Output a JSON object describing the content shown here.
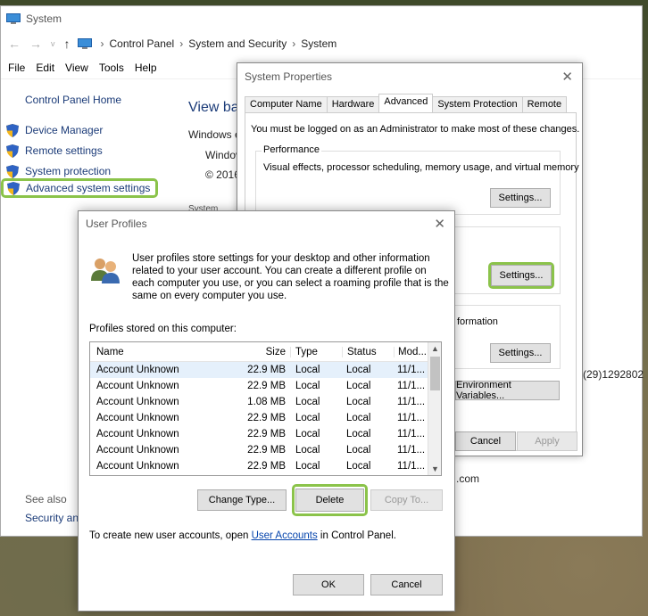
{
  "window": {
    "title": "System"
  },
  "address": {
    "crumbs": [
      "Control Panel",
      "System and Security",
      "System"
    ]
  },
  "menu": [
    "File",
    "Edit",
    "View",
    "Tools",
    "Help"
  ],
  "sidebar": {
    "home": "Control Panel Home",
    "items": [
      {
        "label": "Device Manager"
      },
      {
        "label": "Remote settings"
      },
      {
        "label": "System protection"
      },
      {
        "label": "Advanced system settings"
      }
    ],
    "see_also": "See also",
    "security": "Security and"
  },
  "content": {
    "title": "View bas",
    "line1": "Windows e",
    "line2": "Windov",
    "line3": "© 2016",
    "line4": "System",
    "frag_phone": "(29)1292802",
    "frag_com": ".com",
    "frag_ormation": "formation"
  },
  "sysprop": {
    "title": "System Properties",
    "tabs": [
      "Computer Name",
      "Hardware",
      "Advanced",
      "System Protection",
      "Remote"
    ],
    "active_tab": "Advanced",
    "note": "You must be logged on as an Administrator to make most of these changes.",
    "performance_label": "Performance",
    "performance_text": "Visual effects, processor scheduling, memory usage, and virtual memory",
    "settings_label": "Settings...",
    "env_label": "Environment Variables...",
    "cancel_label": "Cancel",
    "apply_label": "Apply"
  },
  "userprof": {
    "title": "User Profiles",
    "intro": "User profiles store settings for your desktop and other information related to your user account. You can create a different profile on each computer you use, or you can select a roaming profile that is the same on every computer you use.",
    "stored_label": "Profiles stored on this computer:",
    "columns": {
      "name": "Name",
      "size": "Size",
      "type": "Type",
      "status": "Status",
      "modified": "Mod..."
    },
    "rows": [
      {
        "name": "Account Unknown",
        "size": "22.9 MB",
        "type": "Local",
        "status": "Local",
        "modified": "11/1..."
      },
      {
        "name": "Account Unknown",
        "size": "22.9 MB",
        "type": "Local",
        "status": "Local",
        "modified": "11/1..."
      },
      {
        "name": "Account Unknown",
        "size": "1.08 MB",
        "type": "Local",
        "status": "Local",
        "modified": "11/1..."
      },
      {
        "name": "Account Unknown",
        "size": "22.9 MB",
        "type": "Local",
        "status": "Local",
        "modified": "11/1..."
      },
      {
        "name": "Account Unknown",
        "size": "22.9 MB",
        "type": "Local",
        "status": "Local",
        "modified": "11/1..."
      },
      {
        "name": "Account Unknown",
        "size": "22.9 MB",
        "type": "Local",
        "status": "Local",
        "modified": "11/1..."
      },
      {
        "name": "Account Unknown",
        "size": "22.9 MB",
        "type": "Local",
        "status": "Local",
        "modified": "11/1..."
      }
    ],
    "change_type": "Change Type...",
    "delete": "Delete",
    "copy_to": "Copy To...",
    "footer_pre": "To create new user accounts, open",
    "footer_link": "User Accounts",
    "footer_post": "in Control Panel.",
    "ok": "OK",
    "cancel": "Cancel"
  },
  "colors": {
    "highlight": "#8bc34a",
    "link": "#1b3b78",
    "selected_row": "#e5f0fb"
  }
}
